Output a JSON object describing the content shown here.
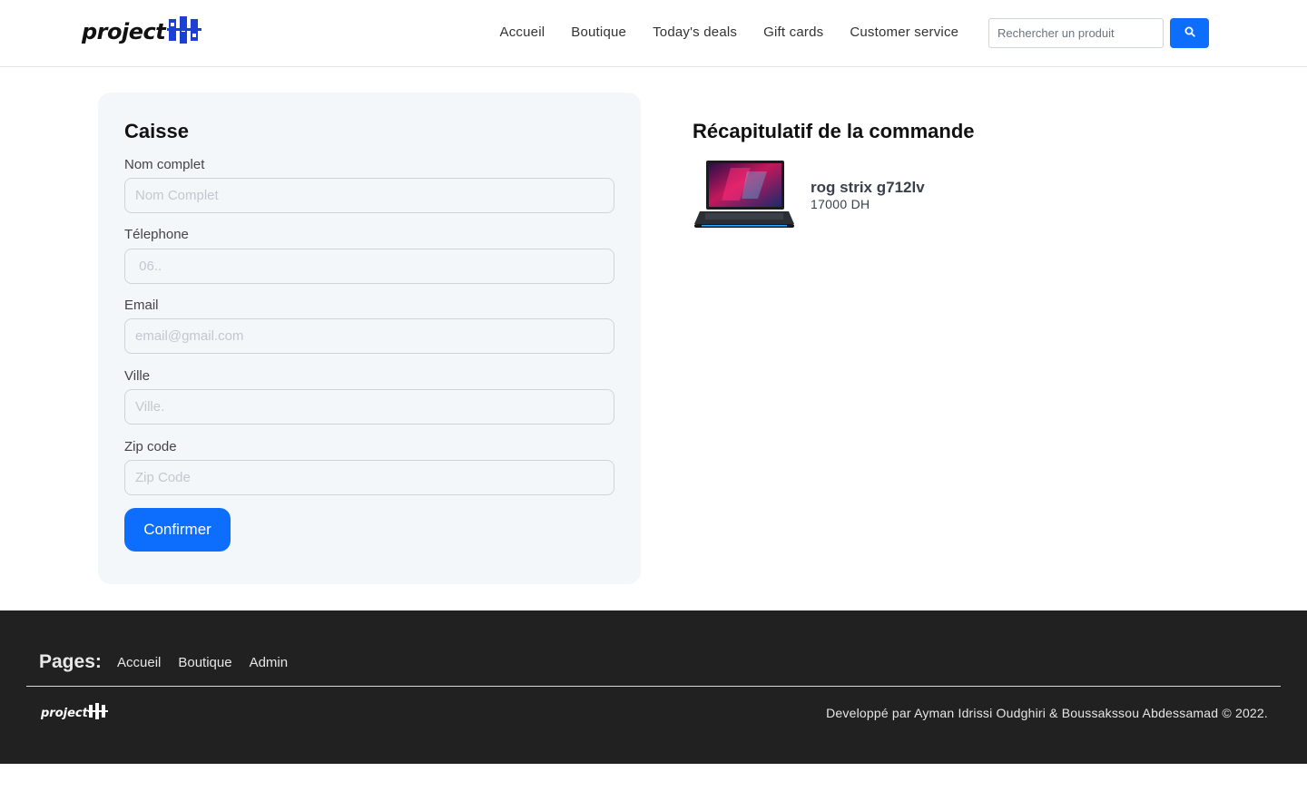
{
  "header": {
    "logo_text": "project",
    "nav": [
      "Accueil",
      "Boutique",
      "Today's deals",
      "Gift cards",
      "Customer service"
    ],
    "search_placeholder": "Rechercher un produit",
    "search_icon": "search-icon"
  },
  "checkout": {
    "title": "Caisse",
    "fields": [
      {
        "label": "Nom complet",
        "placeholder": "Nom Complet"
      },
      {
        "label": "Télephone",
        "placeholder": " 06.."
      },
      {
        "label": "Email",
        "placeholder": "email@gmail.com"
      },
      {
        "label": "Ville",
        "placeholder": "Ville."
      },
      {
        "label": "Zip code",
        "placeholder": "Zip Code"
      }
    ],
    "confirm_label": "Confirmer"
  },
  "summary": {
    "title": "Récapitulatif de la commande",
    "item": {
      "name": "rog strix g712lv",
      "price": "17000 DH"
    }
  },
  "footer": {
    "pages_title": "Pages:",
    "links": [
      "Accueil",
      "Boutique",
      "Admin"
    ],
    "logo_text": "project",
    "credit": "Developpé par Ayman Idrissi Oudghiri & Boussakssou Abdessamad © 2022."
  },
  "colors": {
    "accent": "#0d6efd",
    "footer_bg": "#212121",
    "card_bg": "#f4f7fa"
  }
}
